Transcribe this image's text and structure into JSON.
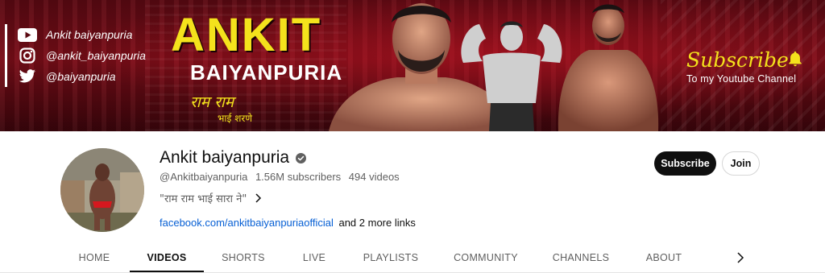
{
  "banner": {
    "social": [
      {
        "icon": "youtube-icon",
        "label": "Ankit baiyanpuria"
      },
      {
        "icon": "instagram-icon",
        "label": "@ankit_baiyanpuria"
      },
      {
        "icon": "twitter-icon",
        "label": "@baiyanpuria"
      }
    ],
    "title_main": "ANKIT",
    "title_sub": "BAIYANPURIA",
    "hindi_tagline": "राम राम",
    "hindi_tagline2": "भाई शरणे",
    "promo_title": "Subscribe",
    "promo_sub": "To my Youtube Channel",
    "colors": {
      "accent_yellow": "#f4e21c",
      "banner_red": "#7a0d18"
    }
  },
  "channel": {
    "name": "Ankit baiyanpuria",
    "verified_icon": "verified-check-icon",
    "handle": "@Ankitbaiyanpuria",
    "subscribers": "1.56M subscribers",
    "videos": "494 videos",
    "description": "\"राम राम भाई सारा ने\"",
    "link": "facebook.com/ankitbaiyanpuriaofficial",
    "more_links": "and 2 more links"
  },
  "actions": {
    "subscribe": "Subscribe",
    "join": "Join"
  },
  "tabs": [
    {
      "label": "HOME",
      "active": false
    },
    {
      "label": "VIDEOS",
      "active": true
    },
    {
      "label": "SHORTS",
      "active": false
    },
    {
      "label": "LIVE",
      "active": false
    },
    {
      "label": "PLAYLISTS",
      "active": false
    },
    {
      "label": "COMMUNITY",
      "active": false
    },
    {
      "label": "CHANNELS",
      "active": false
    },
    {
      "label": "ABOUT",
      "active": false
    }
  ]
}
